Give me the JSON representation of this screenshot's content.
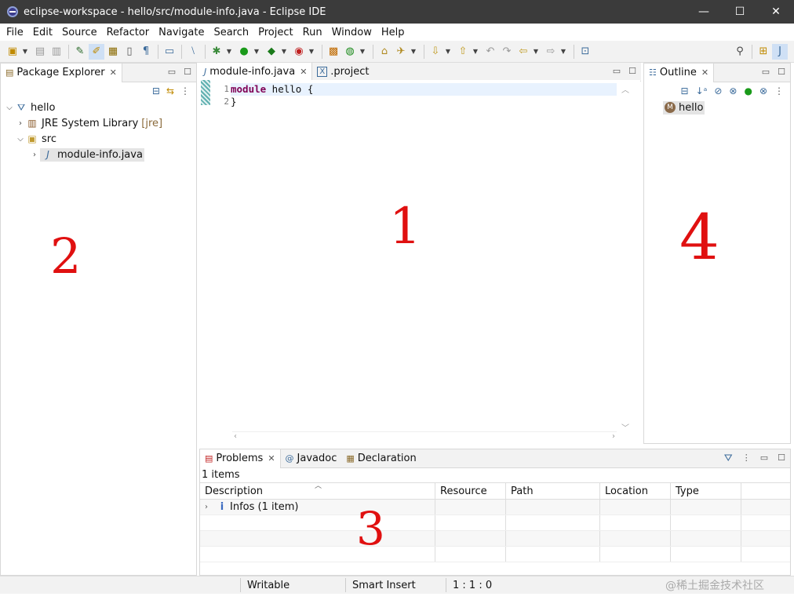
{
  "window": {
    "title": "eclipse-workspace - hello/src/module-info.java - Eclipse IDE",
    "minimize": "—",
    "maximize": "☐",
    "close": "✕"
  },
  "menu": [
    "File",
    "Edit",
    "Source",
    "Refactor",
    "Navigate",
    "Search",
    "Project",
    "Run",
    "Window",
    "Help"
  ],
  "package_explorer": {
    "tab": "Package Explorer",
    "tree": [
      {
        "label": "hello",
        "level": 0,
        "twisty": "⌵",
        "icon": "project-icon"
      },
      {
        "label": "JRE System Library",
        "decoration": "[jre]",
        "level": 1,
        "twisty": "›",
        "icon": "library-icon"
      },
      {
        "label": "src",
        "level": 1,
        "twisty": "⌵",
        "icon": "source-folder-icon"
      },
      {
        "label": "module-info.java",
        "level": 2,
        "twisty": "›",
        "icon": "java-file-icon"
      }
    ]
  },
  "editor": {
    "tabs": [
      {
        "label": "module-info.java",
        "active": true,
        "icon": "J"
      },
      {
        "label": ".project",
        "active": false,
        "icon": "X"
      }
    ],
    "line_numbers": [
      "1",
      "2"
    ],
    "code": {
      "kw": "module",
      "line1_rest": " hello {",
      "line2": "}"
    }
  },
  "outline": {
    "tab": "Outline",
    "item": "hello"
  },
  "problems": {
    "tabs": [
      "Problems",
      "Javadoc",
      "Declaration"
    ],
    "count": "1 items",
    "columns": [
      "Description",
      "Resource",
      "Path",
      "Location",
      "Type"
    ],
    "rows": [
      {
        "description": "Infos (1 item)"
      }
    ]
  },
  "status": {
    "writable": "Writable",
    "mode": "Smart Insert",
    "position": "1 : 1 : 0"
  },
  "annotations": {
    "a1": "1",
    "a2": "2",
    "a3": "3",
    "a4": "4"
  },
  "watermark": "@稀土掘金技术社区"
}
